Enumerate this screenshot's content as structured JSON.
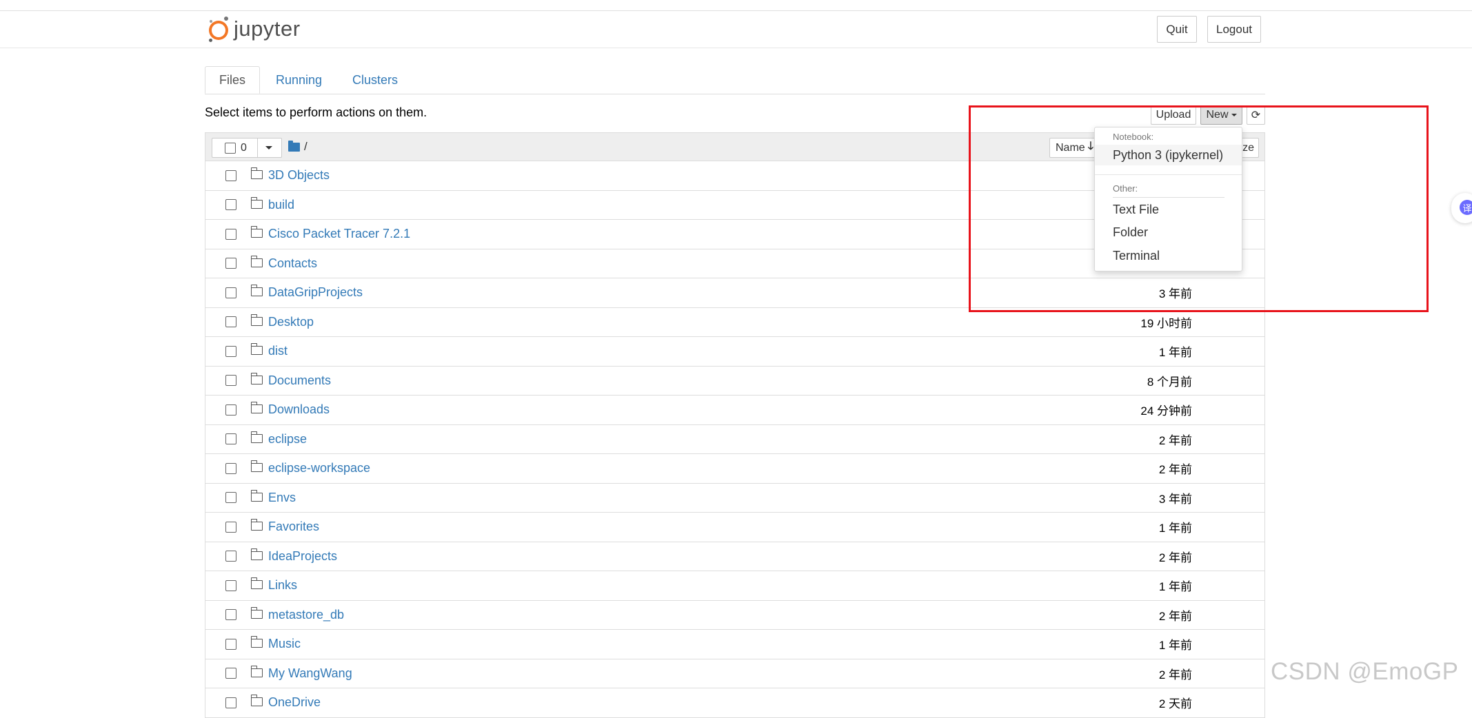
{
  "header": {
    "logo_text": "jupyter",
    "quit_label": "Quit",
    "logout_label": "Logout"
  },
  "tabs": [
    {
      "label": "Files"
    },
    {
      "label": "Running"
    },
    {
      "label": "Clusters"
    }
  ],
  "toolbar": {
    "hint": "Select items to perform actions on them.",
    "upload_label": "Upload",
    "new_label": "New",
    "refresh_icon": "refresh-icon"
  },
  "list_header": {
    "selected_count": "0",
    "breadcrumb": "/",
    "sort_name_label": "Name",
    "sort_name_icon": "arrow-down-icon",
    "sort_size_label": "ze"
  },
  "new_menu": {
    "notebook_header": "Notebook:",
    "python3": "Python 3 (ipykernel)",
    "other_header": "Other:",
    "text_file": "Text File",
    "folder": "Folder",
    "terminal": "Terminal"
  },
  "files": [
    {
      "name": "3D Objects",
      "modified": ""
    },
    {
      "name": "build",
      "modified": ""
    },
    {
      "name": "Cisco Packet Tracer 7.2.1",
      "modified": ""
    },
    {
      "name": "Contacts",
      "modified": ""
    },
    {
      "name": "DataGripProjects",
      "modified": "3 年前"
    },
    {
      "name": "Desktop",
      "modified": "19 小时前"
    },
    {
      "name": "dist",
      "modified": "1 年前"
    },
    {
      "name": "Documents",
      "modified": "8 个月前"
    },
    {
      "name": "Downloads",
      "modified": "24 分钟前"
    },
    {
      "name": "eclipse",
      "modified": "2 年前"
    },
    {
      "name": "eclipse-workspace",
      "modified": "2 年前"
    },
    {
      "name": "Envs",
      "modified": "3 年前"
    },
    {
      "name": "Favorites",
      "modified": "1 年前"
    },
    {
      "name": "IdeaProjects",
      "modified": "2 年前"
    },
    {
      "name": "Links",
      "modified": "1 年前"
    },
    {
      "name": "metastore_db",
      "modified": "2 年前"
    },
    {
      "name": "Music",
      "modified": "1 年前"
    },
    {
      "name": "My WangWang",
      "modified": "2 年前"
    },
    {
      "name": "OneDrive",
      "modified": "2 天前"
    }
  ],
  "watermark": "CSDN @EmoGP",
  "side_bubble_glyph": "译",
  "colors": {
    "link": "#337ab7",
    "jupyter_orange": "#f37726",
    "highlight": "#e8131b"
  }
}
